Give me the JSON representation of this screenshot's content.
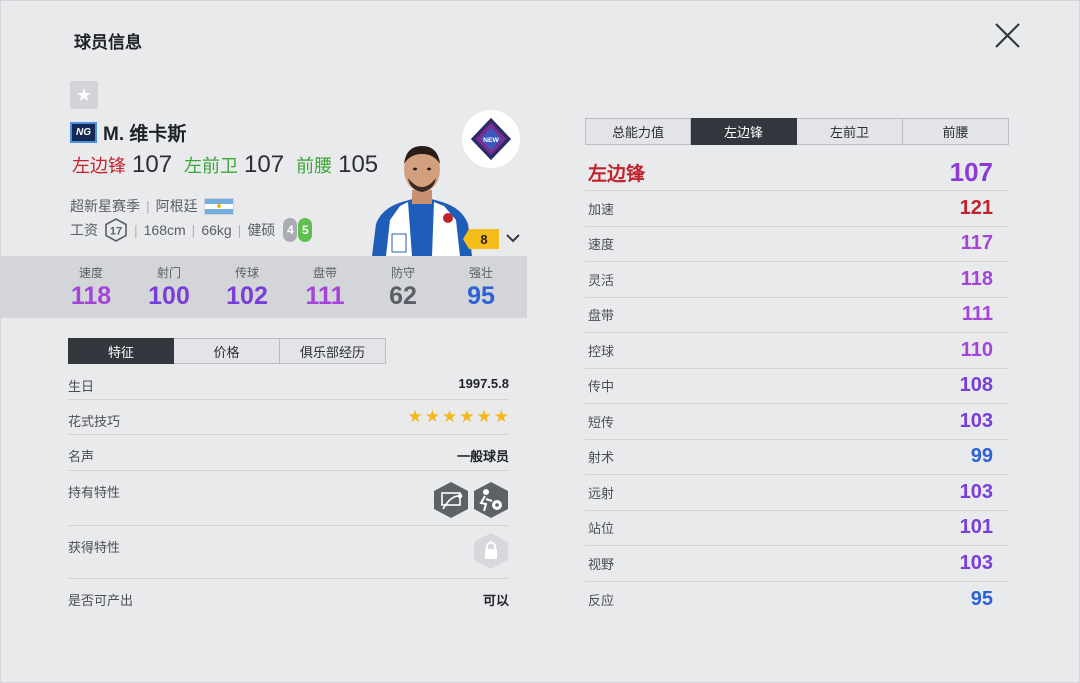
{
  "header": {
    "title": "球员信息"
  },
  "player": {
    "season_badge": "NG",
    "name": "M. 维卡斯",
    "positions": [
      {
        "name": "左边锋",
        "value": "107",
        "color": "#c0232b"
      },
      {
        "name": "左前卫",
        "value": "107",
        "color": "#3da53a"
      },
      {
        "name": "前腰",
        "value": "105",
        "color": "#3da53a"
      }
    ],
    "season": "超新星赛季",
    "nationality": "阿根廷",
    "salary_label": "工资",
    "salary": "17",
    "height": "168cm",
    "weight": "66kg",
    "body_type": "健硕",
    "weak_foot": "4",
    "strong_foot": "5",
    "level": "8",
    "club_logo_text": "NEW"
  },
  "stats": [
    {
      "label": "速度",
      "value": "118",
      "color": "#a445d8"
    },
    {
      "label": "射门",
      "value": "100",
      "color": "#7a3ed8"
    },
    {
      "label": "传球",
      "value": "102",
      "color": "#7a3ed8"
    },
    {
      "label": "盘带",
      "value": "111",
      "color": "#a445d8"
    },
    {
      "label": "防守",
      "value": "62",
      "color": "#5a5e66"
    },
    {
      "label": "强壮",
      "value": "95",
      "color": "#2c62d6"
    }
  ],
  "left_tabs": [
    {
      "label": "特征",
      "active": true
    },
    {
      "label": "价格",
      "active": false
    },
    {
      "label": "俱乐部经历",
      "active": false
    }
  ],
  "info": {
    "birthday_label": "生日",
    "birthday": "1997.5.8",
    "skill_label": "花式技巧",
    "skill_stars": 6,
    "reputation_label": "名声",
    "reputation": "一般球员",
    "traits_label": "持有特性",
    "traits_icons": [
      "finesse-shot-trait-icon",
      "flair-trait-icon"
    ],
    "acquired_label": "获得特性",
    "acquired_icon": "lock-icon",
    "producible_label": "是否可产出",
    "producible": "可以"
  },
  "right_tabs": [
    {
      "label": "总能力值",
      "active": false
    },
    {
      "label": "左边锋",
      "active": true
    },
    {
      "label": "左前卫",
      "active": false
    },
    {
      "label": "前腰",
      "active": false
    }
  ],
  "attr_header": {
    "label": "左边锋",
    "value": "107"
  },
  "attributes": [
    {
      "label": "加速",
      "value": "121",
      "color": "#c0232b"
    },
    {
      "label": "速度",
      "value": "117",
      "color": "#a445d8"
    },
    {
      "label": "灵活",
      "value": "118",
      "color": "#a445d8"
    },
    {
      "label": "盘带",
      "value": "111",
      "color": "#a445d8"
    },
    {
      "label": "控球",
      "value": "110",
      "color": "#a445d8"
    },
    {
      "label": "传中",
      "value": "108",
      "color": "#7a3ed8"
    },
    {
      "label": "短传",
      "value": "103",
      "color": "#7a3ed8"
    },
    {
      "label": "射术",
      "value": "99",
      "color": "#2c62d6"
    },
    {
      "label": "远射",
      "value": "103",
      "color": "#7a3ed8"
    },
    {
      "label": "站位",
      "value": "101",
      "color": "#7a3ed8"
    },
    {
      "label": "视野",
      "value": "103",
      "color": "#7a3ed8"
    },
    {
      "label": "反应",
      "value": "95",
      "color": "#2c62d6"
    }
  ]
}
